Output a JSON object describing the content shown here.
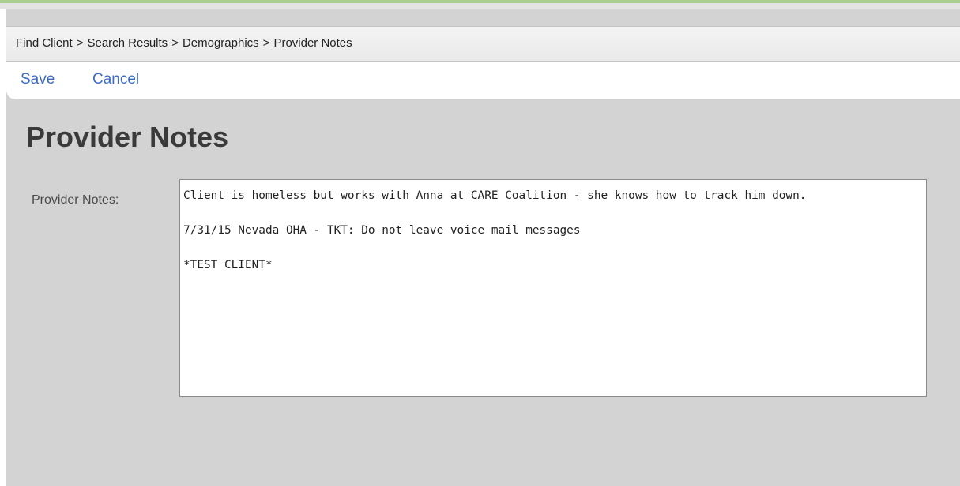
{
  "breadcrumb": {
    "items": [
      "Find Client",
      "Search Results",
      "Demographics",
      "Provider Notes"
    ],
    "separator": ">"
  },
  "toolbar": {
    "save_label": "Save",
    "cancel_label": "Cancel"
  },
  "page": {
    "title": "Provider Notes"
  },
  "provider_notes": {
    "label": "Provider Notes:",
    "value": "Client is homeless but works with Anna at CARE Coalition - she knows how to track him down.\n\n7/31/15 Nevada OHA - TKT: Do not leave voice mail messages\n\n*TEST CLIENT*"
  },
  "colors": {
    "accent": "#a9d08e",
    "link": "#3d6bc4",
    "page_background": "#d3d3d3"
  }
}
